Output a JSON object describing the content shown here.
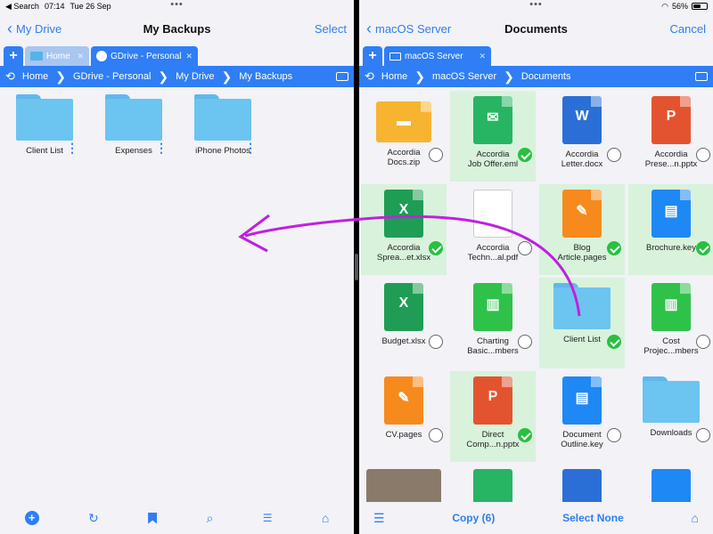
{
  "status": {
    "carrier": "◀ Search",
    "time": "07:14",
    "date": "Tue 26 Sep",
    "battery": "56%",
    "battery_level": 0.56
  },
  "left": {
    "back_label": "My Drive",
    "title": "My Backups",
    "action": "Select",
    "tabs": [
      {
        "label": "Home"
      },
      {
        "label": "GDrive - Personal"
      }
    ],
    "path": [
      "Home",
      "GDrive - Personal",
      "My Drive",
      "My Backups"
    ],
    "items": [
      {
        "label": "Client List"
      },
      {
        "label": "Expenses"
      },
      {
        "label": "iPhone Photos"
      }
    ]
  },
  "right": {
    "back_label": "macOS Server",
    "title": "Documents",
    "action": "Cancel",
    "tabs": [
      {
        "label": "macOS Server"
      }
    ],
    "path": [
      "Home",
      "macOS Server",
      "Documents"
    ],
    "items": [
      {
        "label": "Accordia\nDocs.zip",
        "kind": "zip",
        "selected": false
      },
      {
        "label": "Accordia\nJob Offer.eml",
        "kind": "eml",
        "selected": true
      },
      {
        "label": "Accordia\nLetter.docx",
        "kind": "docx",
        "selected": false
      },
      {
        "label": "Accordia\nPrese...n.pptx",
        "kind": "pptx",
        "selected": false
      },
      {
        "label": "Accordia\nSprea...et.xlsx",
        "kind": "xlsx",
        "selected": true
      },
      {
        "label": "Accordia\nTechn...al.pdf",
        "kind": "pdf",
        "selected": false
      },
      {
        "label": "Blog\nArticle.pages",
        "kind": "pages",
        "selected": true
      },
      {
        "label": "Brochure.key",
        "kind": "key",
        "selected": true
      },
      {
        "label": "Budget.xlsx",
        "kind": "xlsx",
        "selected": false
      },
      {
        "label": "Charting\nBasic...mbers",
        "kind": "numbers",
        "selected": false
      },
      {
        "label": "Client List",
        "kind": "folder",
        "selected": true
      },
      {
        "label": "Cost\nProjec...mbers",
        "kind": "numbers",
        "selected": false
      },
      {
        "label": "CV.pages",
        "kind": "pages",
        "selected": false
      },
      {
        "label": "Direct\nComp...n.pptx",
        "kind": "pptx",
        "selected": true
      },
      {
        "label": "Document\nOutline.key",
        "kind": "key",
        "selected": false
      },
      {
        "label": "Downloads",
        "kind": "folder",
        "selected": false
      }
    ],
    "copy_label": "Copy (6)",
    "select_none_label": "Select None"
  },
  "colors": {
    "accent": "#2f7ef5",
    "selected_bg": "#d8f2dc",
    "check": "#28c040",
    "arrow": "#c020e0"
  }
}
